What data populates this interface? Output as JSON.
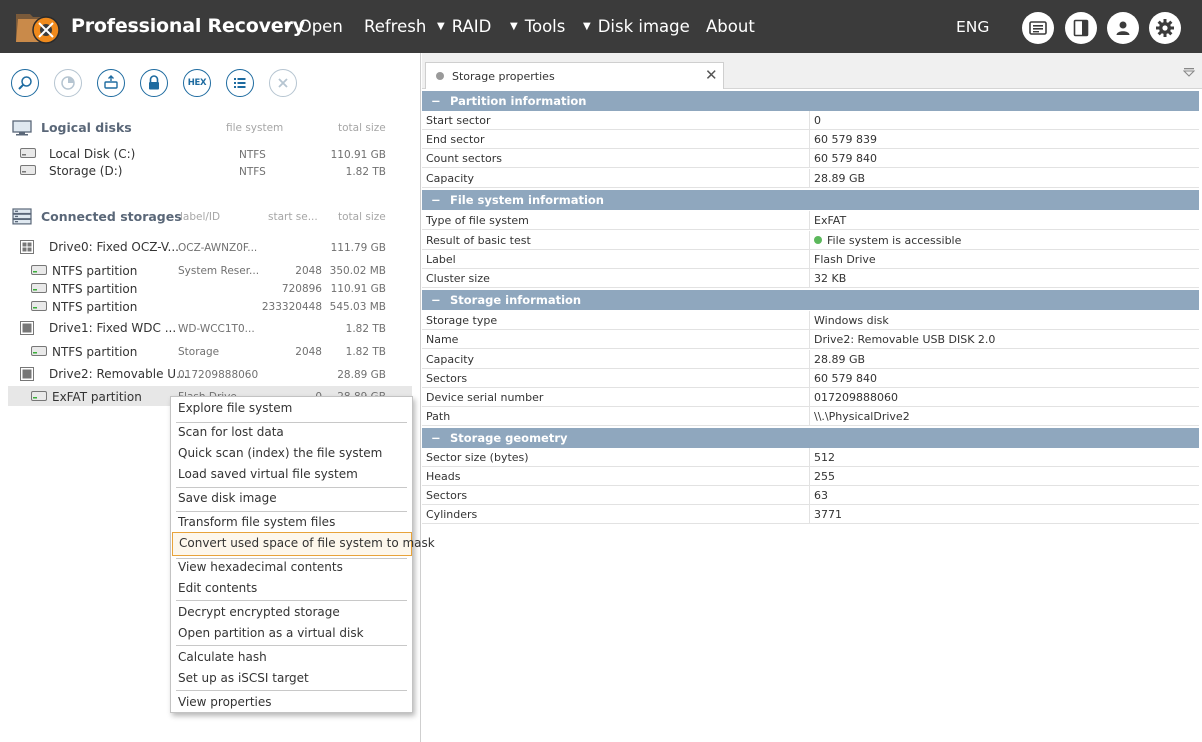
{
  "app": {
    "title": "Professional Recovery"
  },
  "menu": {
    "items": [
      {
        "label": "Open",
        "has_arrow": true
      },
      {
        "label": "Refresh",
        "has_arrow": false
      },
      {
        "label": "RAID",
        "has_arrow": true
      },
      {
        "label": "Tools",
        "has_arrow": true
      },
      {
        "label": "Disk image",
        "has_arrow": true
      },
      {
        "label": "About",
        "has_arrow": false
      }
    ],
    "language": "ENG",
    "icons": [
      "news-icon",
      "panel-icon",
      "user-icon",
      "gear-icon"
    ]
  },
  "toolbar": {
    "hex_label": "HEX",
    "icons": [
      "search-icon",
      "scan-icon",
      "copy-icon",
      "lock-icon",
      "hex-icon",
      "list-icon",
      "close-icon"
    ]
  },
  "logical": {
    "title": "Logical disks",
    "col_fs": "file system",
    "col_size": "total size",
    "rows": [
      {
        "name": "Local Disk (C:)",
        "fs": "NTFS",
        "size": "110.91 GB"
      },
      {
        "name": "Storage (D:)",
        "fs": "NTFS",
        "size": "1.82 TB"
      }
    ]
  },
  "connected": {
    "title": "Connected storages",
    "col_label": "label/ID",
    "col_start": "start se...",
    "col_size": "total size",
    "rows": [
      {
        "name": "Drive0: Fixed OCZ-V...",
        "label": "OCZ-AWNZ0F...",
        "start": "",
        "size": "111.79 GB",
        "kind": "drive"
      },
      {
        "name": "NTFS partition",
        "label": "System Reser...",
        "start": "2048",
        "size": "350.02 MB",
        "kind": "part"
      },
      {
        "name": "NTFS partition",
        "label": "",
        "start": "720896",
        "size": "110.91 GB",
        "kind": "part"
      },
      {
        "name": "NTFS partition",
        "label": "",
        "start": "233320448",
        "size": "545.03 MB",
        "kind": "part"
      },
      {
        "name": "Drive1: Fixed WDC ...",
        "label": "WD-WCC1T0...",
        "start": "",
        "size": "1.82 TB",
        "kind": "drive"
      },
      {
        "name": "NTFS partition",
        "label": "Storage",
        "start": "2048",
        "size": "1.82 TB",
        "kind": "part"
      },
      {
        "name": "Drive2: Removable U...",
        "label": "017209888060",
        "start": "",
        "size": "28.89 GB",
        "kind": "drive"
      },
      {
        "name": "ExFAT partition",
        "label": "Flash Drive",
        "start": "0",
        "size": "28.89 GB",
        "kind": "part"
      }
    ]
  },
  "context_menu": {
    "items": [
      "Explore file system",
      "Scan for lost data",
      "Quick scan (index) the file system",
      "Load saved virtual file system",
      "Save disk image",
      "Transform file system files",
      "Convert used space of file system to mask",
      "View hexadecimal contents",
      "Edit contents",
      "Decrypt encrypted storage",
      "Open partition as a virtual disk",
      "Calculate hash",
      "Set up as iSCSI target",
      "View properties"
    ],
    "highlighted": "Convert used space of file system to mask"
  },
  "properties": {
    "tab_label": "Storage properties",
    "groups": [
      {
        "title": "Partition information",
        "rows": [
          {
            "key": "Start sector",
            "value": "0"
          },
          {
            "key": "End sector",
            "value": "60 579 839"
          },
          {
            "key": "Count sectors",
            "value": "60 579 840"
          },
          {
            "key": "Capacity",
            "value": "28.89 GB"
          }
        ]
      },
      {
        "title": "File system information",
        "rows": [
          {
            "key": "Type of file system",
            "value": "ExFAT"
          },
          {
            "key": "Result of basic test",
            "value": "File system is accessible",
            "status": "ok"
          },
          {
            "key": "Label",
            "value": "Flash Drive"
          },
          {
            "key": "Cluster size",
            "value": "32 KB"
          }
        ]
      },
      {
        "title": "Storage information",
        "rows": [
          {
            "key": "Storage type",
            "value": "Windows disk"
          },
          {
            "key": "Name",
            "value": "Drive2: Removable USB DISK 2.0"
          },
          {
            "key": "Capacity",
            "value": "28.89 GB"
          },
          {
            "key": "Sectors",
            "value": "60 579 840"
          },
          {
            "key": "Device serial number",
            "value": "017209888060"
          },
          {
            "key": "Path",
            "value": "\\\\.\\PhysicalDrive2"
          }
        ]
      },
      {
        "title": "Storage geometry",
        "rows": [
          {
            "key": "Sector size (bytes)",
            "value": "512"
          },
          {
            "key": "Heads",
            "value": "255"
          },
          {
            "key": "Sectors",
            "value": "63"
          },
          {
            "key": "Cylinders",
            "value": "3771"
          }
        ]
      }
    ]
  },
  "colors": {
    "topbar": "#3b3b3b",
    "group_header": "#8fa7be",
    "accent": "#1e6ba0",
    "highlight_border": "#e8a33a",
    "status_ok": "#5cb85c"
  }
}
